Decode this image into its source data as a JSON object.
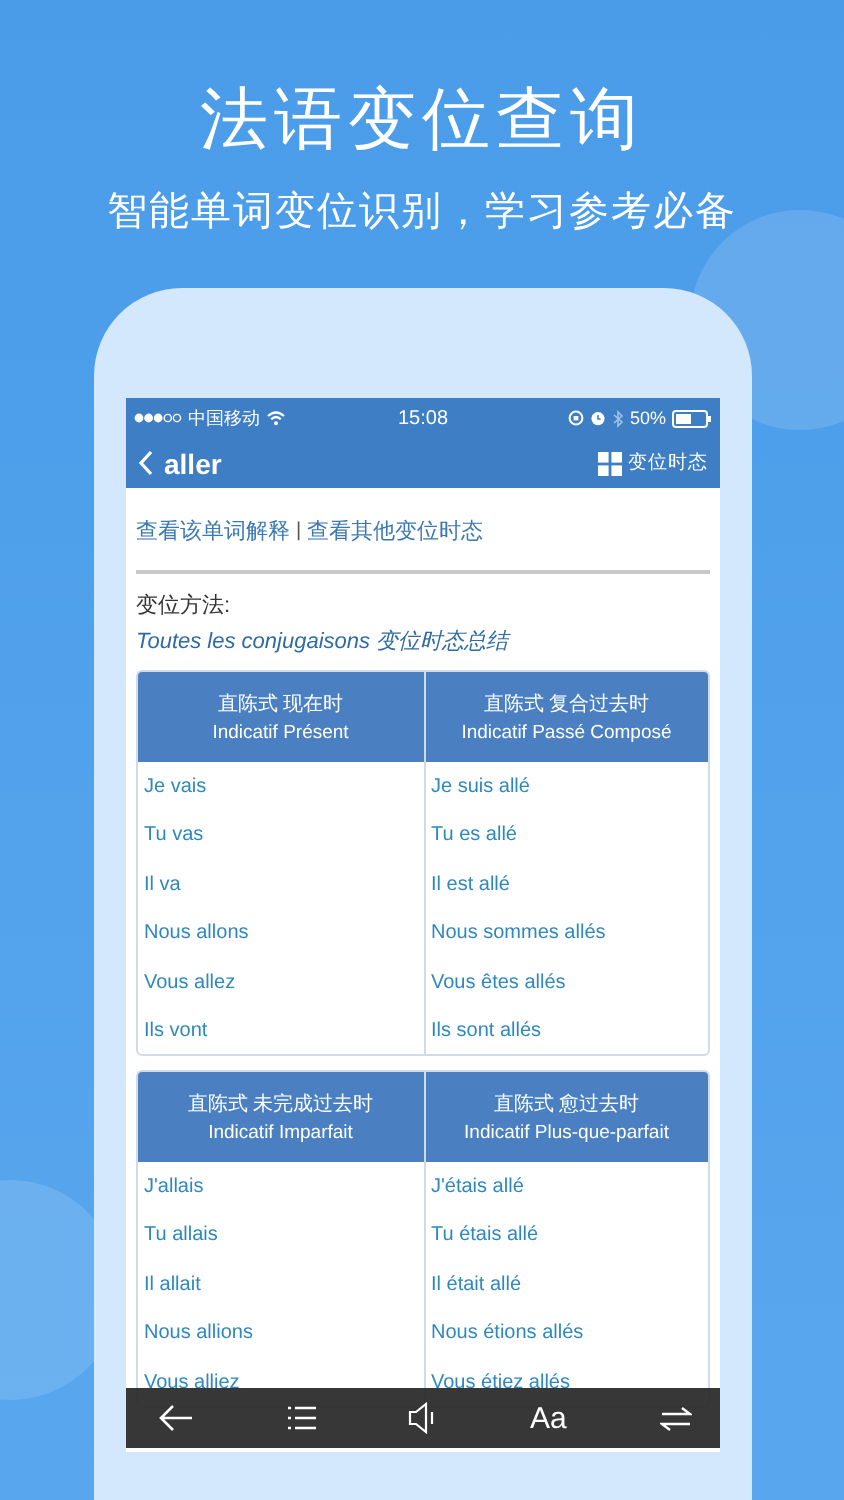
{
  "title": "法语变位查询",
  "subtitle": "智能单词变位识别，学习参考必备",
  "status_bar": {
    "carrier": "中国移动",
    "time": "15:08",
    "battery": "50%"
  },
  "nav": {
    "word": "aller",
    "action": "变位时态"
  },
  "links": [
    "查看该单词解释",
    "查看其他变位时态"
  ],
  "link_separator": "|",
  "method_label": "变位方法:",
  "method_link": "Toutes les conjugaisons 变位时态总结",
  "tables": [
    {
      "columns": [
        {
          "zh": "直陈式 现在时",
          "fr": "Indicatif Présent",
          "forms": [
            "Je vais",
            "Tu vas",
            "Il va",
            "Nous allons",
            "Vous allez",
            "Ils vont"
          ]
        },
        {
          "zh": "直陈式 复合过去时",
          "fr": "Indicatif Passé Composé",
          "forms": [
            "Je suis allé",
            "Tu es allé",
            "Il est allé",
            "Nous sommes allés",
            "Vous êtes allés",
            "Ils sont allés"
          ]
        }
      ]
    },
    {
      "columns": [
        {
          "zh": "直陈式 未完成过去时",
          "fr": "Indicatif Imparfait",
          "forms": [
            "J'allais",
            "Tu allais",
            "Il allait",
            "Nous allions",
            "Vous alliez"
          ]
        },
        {
          "zh": "直陈式 愈过去时",
          "fr": "Indicatif Plus-que-parfait",
          "forms": [
            "J'étais allé",
            "Tu étais allé",
            "Il était allé",
            "Nous étions allés",
            "Vous étiez allés"
          ]
        }
      ]
    }
  ],
  "toolbar": {
    "font_button": "Aa"
  }
}
